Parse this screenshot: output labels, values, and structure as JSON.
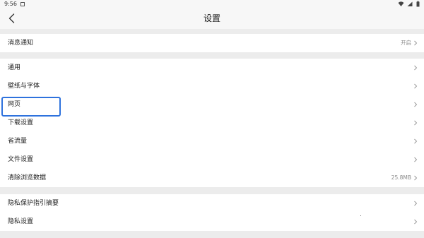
{
  "status_bar": {
    "time": "9:56"
  },
  "header": {
    "title": "设置",
    "back_icon": "chevron-left-icon"
  },
  "groups": [
    {
      "items": [
        {
          "label": "消息通知",
          "value": "开启"
        }
      ]
    },
    {
      "items": [
        {
          "label": "通用",
          "value": ""
        },
        {
          "label": "壁纸与字体",
          "value": ""
        },
        {
          "label": "网页",
          "value": "",
          "highlighted": true
        },
        {
          "label": "下载设置",
          "value": ""
        },
        {
          "label": "省流量",
          "value": ""
        },
        {
          "label": "文件设置",
          "value": ""
        },
        {
          "label": "清除浏览数据",
          "value": "25.8MB"
        }
      ]
    },
    {
      "items": [
        {
          "label": "隐私保护指引摘要",
          "value": ""
        },
        {
          "label": "隐私设置",
          "value": ""
        }
      ]
    }
  ],
  "colors": {
    "background": "#ececec",
    "surface": "#ffffff",
    "highlight": "#2e72dd",
    "secondary_text": "#8a8a8a"
  }
}
